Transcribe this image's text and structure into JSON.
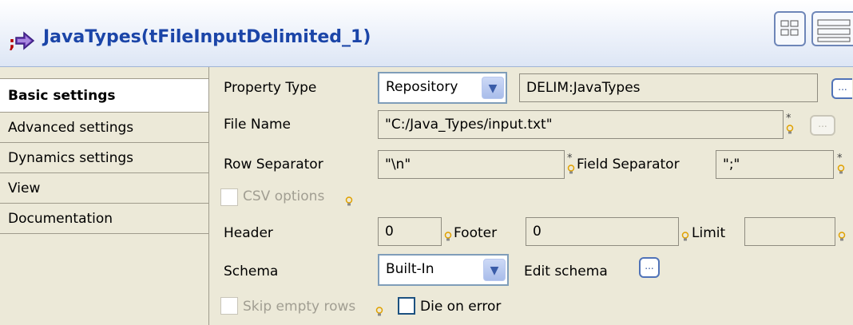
{
  "header": {
    "title": "JavaTypes(tFileInputDelimited_1)"
  },
  "sidebar": {
    "items": [
      {
        "label": "Basic settings",
        "active": true
      },
      {
        "label": "Advanced settings"
      },
      {
        "label": "Dynamics settings"
      },
      {
        "label": "View"
      },
      {
        "label": "Documentation"
      }
    ]
  },
  "form": {
    "property_type": {
      "label": "Property Type",
      "value": "Repository",
      "repository": "DELIM:JavaTypes"
    },
    "file_name": {
      "label": "File Name",
      "value": "\"C:/Java_Types/input.txt\""
    },
    "row_separator": {
      "label": "Row Separator",
      "value": "\"\\n\""
    },
    "field_separator": {
      "label": "Field Separator",
      "value": "\";\""
    },
    "csv_options": {
      "label": "CSV options"
    },
    "header": {
      "label": "Header",
      "value": "0"
    },
    "footer": {
      "label": "Footer",
      "value": "0"
    },
    "limit": {
      "label": "Limit",
      "value": ""
    },
    "schema": {
      "label": "Schema",
      "value": "Built-In"
    },
    "edit_schema": {
      "label": "Edit schema"
    },
    "skip_empty_rows": {
      "label": "Skip empty rows"
    },
    "die_on_error": {
      "label": "Die on error"
    },
    "browse_label": "...",
    "required_mark": "*"
  }
}
